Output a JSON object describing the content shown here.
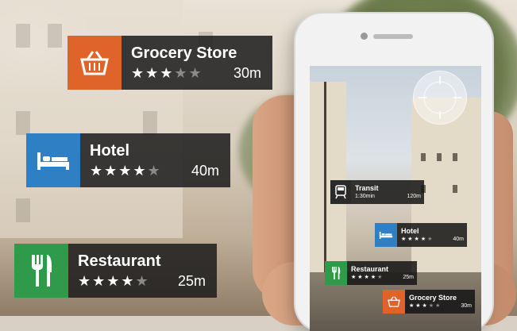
{
  "colors": {
    "grocery": "#e0642a",
    "hotel": "#2f7fc4",
    "restaurant": "#2e9a4a",
    "transit": "#2a2a2a",
    "card_bg": "#1c1c1c"
  },
  "cards": [
    {
      "title": "Grocery Store",
      "rating": 3,
      "distance": "30m",
      "icon": "shopping-basket-icon"
    },
    {
      "title": "Hotel",
      "rating": 4,
      "distance": "40m",
      "icon": "bed-icon"
    },
    {
      "title": "Restaurant",
      "rating": 4,
      "distance": "25m",
      "icon": "fork-knife-icon"
    }
  ],
  "screen_cards": [
    {
      "title": "Transit",
      "sub": "1:30min",
      "distance": "120m",
      "icon": "train-icon"
    },
    {
      "title": "Hotel",
      "rating": 4,
      "distance": "40m",
      "icon": "bed-icon"
    },
    {
      "title": "Restaurant",
      "rating": 4,
      "distance": "25m",
      "icon": "fork-knife-icon"
    },
    {
      "title": "Grocery Store",
      "rating": 3,
      "distance": "30m",
      "icon": "shopping-basket-icon"
    }
  ]
}
